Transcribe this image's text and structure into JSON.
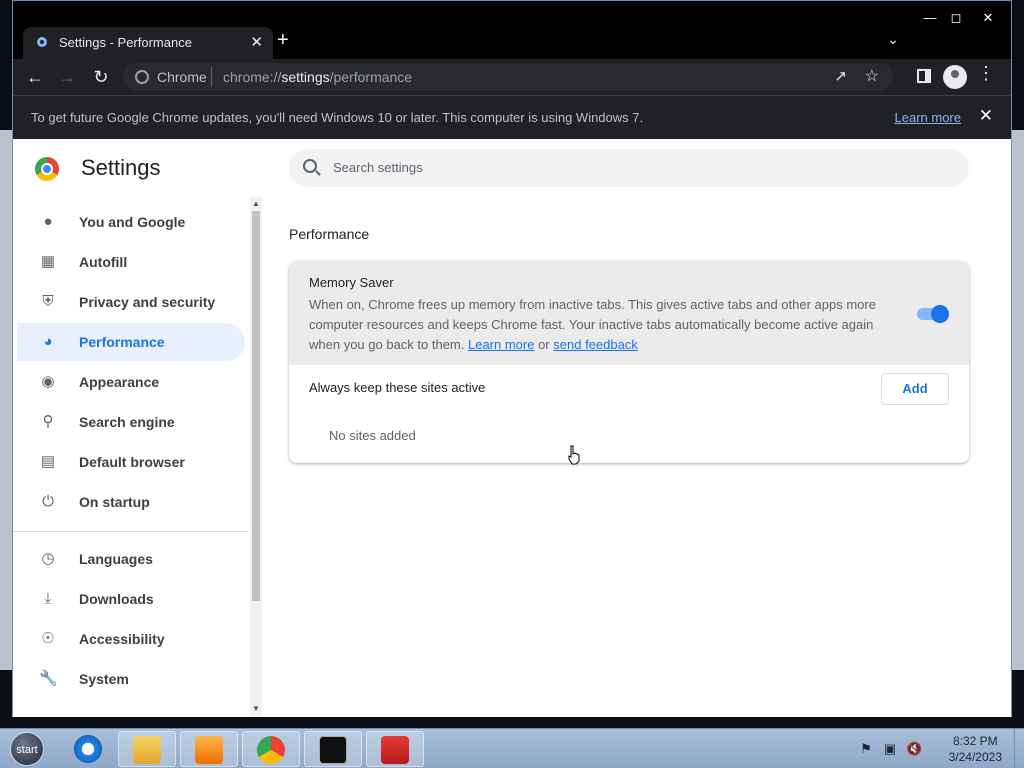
{
  "browser": {
    "tab_title": "Settings - Performance",
    "new_tab_glyph": "+",
    "omnibox": {
      "site_label": "Chrome",
      "url_prefix": "chrome://",
      "url_host": "settings",
      "url_path": "/performance"
    }
  },
  "infobar": {
    "message": "To get future Google Chrome updates, you'll need Windows 10 or later. This computer is using Windows 7.",
    "learn_more": "Learn more"
  },
  "settings": {
    "title": "Settings",
    "search_placeholder": "Search settings",
    "nav": [
      {
        "label": "You and Google",
        "icon": "person-icon"
      },
      {
        "label": "Autofill",
        "icon": "clipboard-icon"
      },
      {
        "label": "Privacy and security",
        "icon": "shield-icon"
      },
      {
        "label": "Performance",
        "icon": "speedometer-icon",
        "active": true
      },
      {
        "label": "Appearance",
        "icon": "palette-icon"
      },
      {
        "label": "Search engine",
        "icon": "search-icon"
      },
      {
        "label": "Default browser",
        "icon": "browser-window-icon"
      },
      {
        "label": "On startup",
        "icon": "power-icon"
      },
      {
        "label": "Languages",
        "icon": "globe-icon"
      },
      {
        "label": "Downloads",
        "icon": "download-icon"
      },
      {
        "label": "Accessibility",
        "icon": "accessibility-icon"
      },
      {
        "label": "System",
        "icon": "wrench-icon"
      }
    ],
    "section_title": "Performance",
    "memory_saver": {
      "title": "Memory Saver",
      "description_before": "When on, Chrome frees up memory from inactive tabs. This gives active tabs and other apps more computer resources and keeps Chrome fast. Your inactive tabs automatically become active again when you go back to them. ",
      "learn_more": "Learn more",
      "or": " or ",
      "send_feedback": "send feedback",
      "enabled": true,
      "toggle_color": "#1a73e8"
    },
    "always_active": {
      "label": "Always keep these sites active",
      "add_button": "Add",
      "empty_text": "No sites added"
    }
  },
  "taskbar": {
    "start_label": "start",
    "apps": [
      "internet-explorer-icon",
      "file-explorer-icon",
      "media-player-icon",
      "chrome-icon",
      "terminal-icon",
      "toolbox-icon"
    ],
    "time": "8:32 PM",
    "date": "3/24/2023"
  }
}
